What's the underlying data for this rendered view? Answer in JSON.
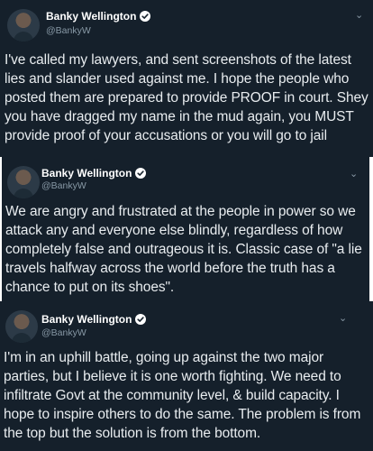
{
  "tweets": [
    {
      "display_name": "Banky Wellington",
      "handle": "@BankyW",
      "text": "I've called my lawyers, and sent screenshots of the latest lies and slander used against me. I hope the people who posted them are prepared to provide PROOF in court. Shey you have dragged my name in the mud again, you MUST provide proof of your accusations or you will go to jail"
    },
    {
      "display_name": "Banky Wellington",
      "handle": "@BankyW",
      "text": "We are angry and frustrated at the people in power so we attack any and everyone else blindly, regardless of how completely false and outrageous it is. Classic case of \"a lie travels halfway across the world before the truth has a chance to put on its shoes\"."
    },
    {
      "display_name": "Banky Wellington",
      "handle": "@BankyW",
      "text": "I'm in an uphill battle, going up against the two major parties, but I believe it is one worth fighting. We need to infiltrate Govt at the community level, & build capacity. I hope to inspire others to do the same. The problem is from the top but the solution is from the bottom."
    }
  ],
  "icons": {
    "verified": "verified-badge-icon",
    "more": "chevron-down-icon",
    "avatar": "avatar"
  },
  "colors": {
    "background": "#15202b",
    "text": "#e8ecef",
    "secondary": "#8899a6"
  }
}
